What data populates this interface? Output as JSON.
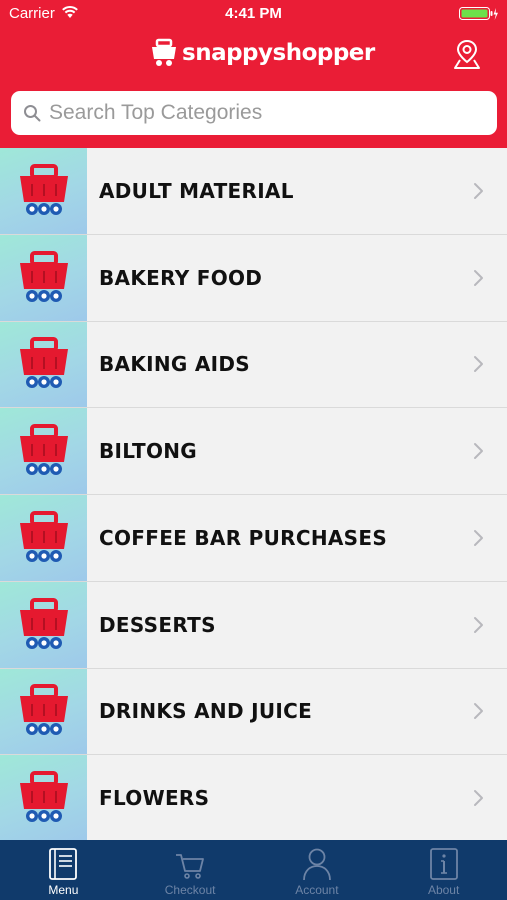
{
  "status_bar": {
    "carrier": "Carrier",
    "time": "4:41 PM"
  },
  "header": {
    "logo_text": "snappyshopper",
    "logo_icon": "basket-logo-icon",
    "location_icon": "location-pin-icon"
  },
  "search": {
    "placeholder": "Search Top Categories",
    "icon": "search-icon"
  },
  "categories": [
    {
      "label": "ADULT MATERIAL"
    },
    {
      "label": "BAKERY FOOD"
    },
    {
      "label": "BAKING AIDS"
    },
    {
      "label": "BILTONG"
    },
    {
      "label": "COFFEE BAR PURCHASES"
    },
    {
      "label": "DESSERTS"
    },
    {
      "label": "DRINKS AND JUICE"
    },
    {
      "label": "FLOWERS"
    }
  ],
  "tabs": [
    {
      "label": "Menu",
      "icon": "menu-book-icon",
      "active": true
    },
    {
      "label": "Checkout",
      "icon": "cart-icon",
      "active": false
    },
    {
      "label": "Account",
      "icon": "user-icon",
      "active": false
    },
    {
      "label": "About",
      "icon": "info-icon",
      "active": false
    }
  ],
  "colors": {
    "brand_red": "#ea1d36",
    "tabbar_blue": "#103a6b",
    "thumb_teal": "#a2d7e6"
  }
}
